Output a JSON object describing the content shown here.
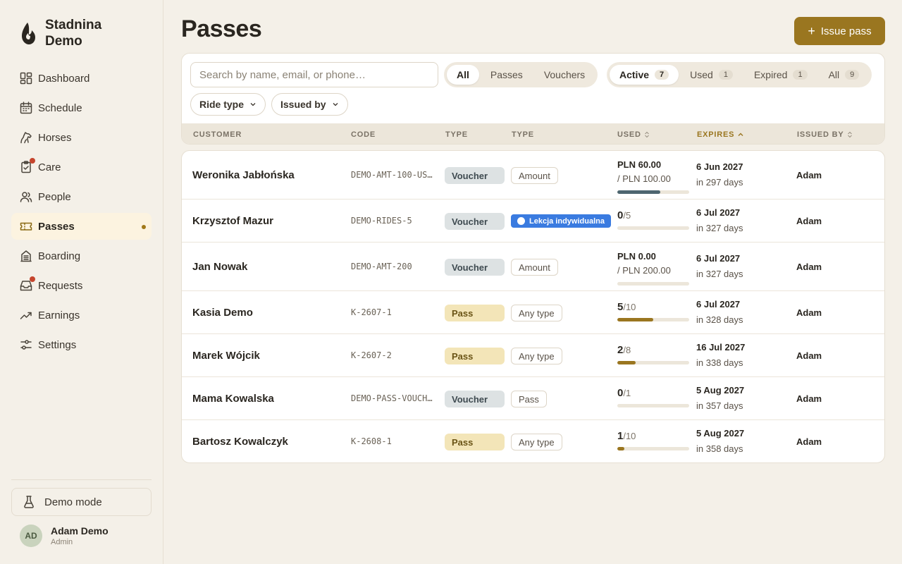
{
  "brand": {
    "name_line1": "Stadnina",
    "name_line2": "Demo"
  },
  "nav": [
    {
      "label": "Dashboard",
      "icon": "dashboard-icon",
      "badge": false,
      "active": false
    },
    {
      "label": "Schedule",
      "icon": "calendar-icon",
      "badge": false,
      "active": false
    },
    {
      "label": "Horses",
      "icon": "horse-icon",
      "badge": false,
      "active": false
    },
    {
      "label": "Care",
      "icon": "clipboard-icon",
      "badge": true,
      "active": false
    },
    {
      "label": "People",
      "icon": "people-icon",
      "badge": false,
      "active": false
    },
    {
      "label": "Passes",
      "icon": "ticket-icon",
      "badge": false,
      "active": true
    },
    {
      "label": "Boarding",
      "icon": "building-icon",
      "badge": false,
      "active": false
    },
    {
      "label": "Requests",
      "icon": "inbox-icon",
      "badge": true,
      "active": false
    },
    {
      "label": "Earnings",
      "icon": "trend-icon",
      "badge": false,
      "active": false
    },
    {
      "label": "Settings",
      "icon": "sliders-icon",
      "badge": false,
      "active": false
    }
  ],
  "demo_mode": {
    "label": "Demo mode",
    "icon": "flask-icon"
  },
  "user": {
    "initials": "AD",
    "name": "Adam Demo",
    "role": "Admin"
  },
  "page": {
    "title": "Passes",
    "issue_button": "Issue pass"
  },
  "filters": {
    "search_placeholder": "Search by name, email, or phone…",
    "kind_tabs": [
      {
        "label": "All",
        "selected": true
      },
      {
        "label": "Passes",
        "selected": false
      },
      {
        "label": "Vouchers",
        "selected": false
      }
    ],
    "status_tabs": [
      {
        "label": "Active",
        "count": "7",
        "selected": true
      },
      {
        "label": "Used",
        "count": "1",
        "selected": false
      },
      {
        "label": "Expired",
        "count": "1",
        "selected": false
      },
      {
        "label": "All",
        "count": "9",
        "selected": false
      }
    ],
    "ride_type": "Ride type",
    "issued_by": "Issued by"
  },
  "columns": {
    "customer": "CUSTOMER",
    "code": "CODE",
    "type": "TYPE",
    "type2": "TYPE",
    "used": "USED",
    "expires": "EXPIRES",
    "issued_by": "ISSUED BY"
  },
  "colors": {
    "accent": "#9a7620",
    "voucher_bar": "#4e6670",
    "pass_bar": "#9a7620",
    "badge_red": "#c5452d",
    "lesson_blue": "#3a7be0"
  },
  "rows": [
    {
      "customer": "Weronika Jabłońska",
      "code": "DEMO-AMT-100-US…",
      "type": "Voucher",
      "type2": "Amount",
      "type2_style": "plain",
      "used_mode": "amount",
      "used_amount": "PLN 60.00",
      "used_total": "/ PLN 100.00",
      "progress": 0.6,
      "expires": "6 Jun 2027",
      "relative": "in 297 days",
      "issued_by": "Adam"
    },
    {
      "customer": "Krzysztof Mazur",
      "code": "DEMO-RIDES-5",
      "type": "Voucher",
      "type2": "Lekcja indywidualna",
      "type2_style": "blue",
      "used_mode": "count",
      "used_num": "0",
      "used_den": "/5",
      "progress": 0,
      "expires": "6 Jul 2027",
      "relative": "in 327 days",
      "issued_by": "Adam"
    },
    {
      "customer": "Jan Nowak",
      "code": "DEMO-AMT-200",
      "type": "Voucher",
      "type2": "Amount",
      "type2_style": "plain",
      "used_mode": "amount",
      "used_amount": "PLN 0.00",
      "used_total": "/ PLN 200.00",
      "progress": 0,
      "expires": "6 Jul 2027",
      "relative": "in 327 days",
      "issued_by": "Adam"
    },
    {
      "customer": "Kasia Demo",
      "code": "K-2607-1",
      "type": "Pass",
      "type2": "Any type",
      "type2_style": "plain",
      "used_mode": "count",
      "used_num": "5",
      "used_den": "/10",
      "progress": 0.5,
      "expires": "6 Jul 2027",
      "relative": "in 328 days",
      "issued_by": "Adam"
    },
    {
      "customer": "Marek Wójcik",
      "code": "K-2607-2",
      "type": "Pass",
      "type2": "Any type",
      "type2_style": "plain",
      "used_mode": "count",
      "used_num": "2",
      "used_den": "/8",
      "progress": 0.25,
      "expires": "16 Jul 2027",
      "relative": "in 338 days",
      "issued_by": "Adam"
    },
    {
      "customer": "Mama Kowalska",
      "code": "DEMO-PASS-VOUCH…",
      "type": "Voucher",
      "type2": "Pass",
      "type2_style": "plain",
      "used_mode": "count",
      "used_num": "0",
      "used_den": "/1",
      "progress": 0,
      "expires": "5 Aug 2027",
      "relative": "in 357 days",
      "issued_by": "Adam"
    },
    {
      "customer": "Bartosz Kowalczyk",
      "code": "K-2608-1",
      "type": "Pass",
      "type2": "Any type",
      "type2_style": "plain",
      "used_mode": "count",
      "used_num": "1",
      "used_den": "/10",
      "progress": 0.1,
      "expires": "5 Aug 2027",
      "relative": "in 358 days",
      "issued_by": "Adam"
    }
  ]
}
